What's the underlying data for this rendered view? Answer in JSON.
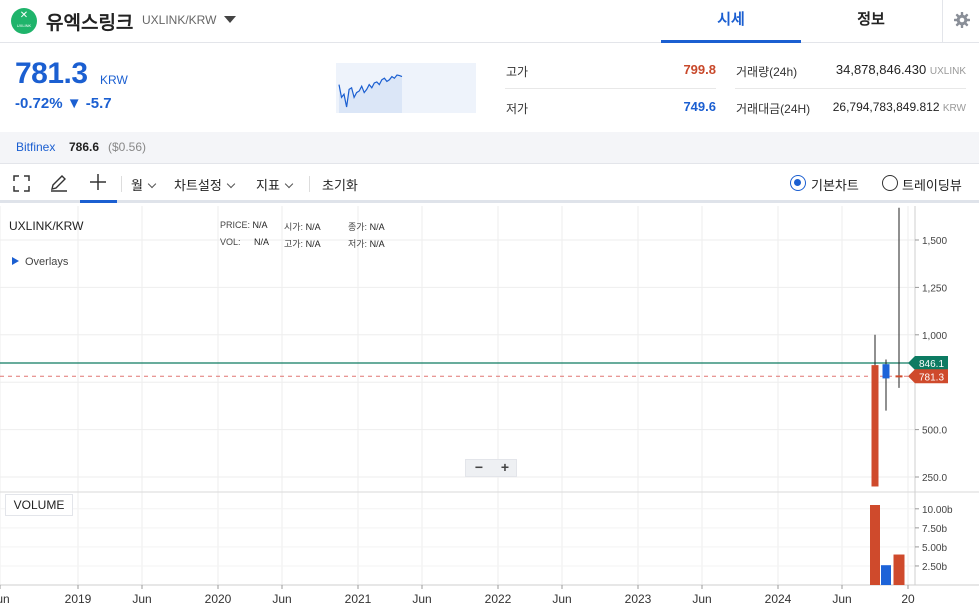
{
  "header": {
    "logo_text": "UXLINK",
    "coin_name": "유엑스링크",
    "pair": "UXLINK/KRW",
    "tabs": [
      {
        "label": "시세"
      },
      {
        "label": "정보"
      }
    ]
  },
  "summary": {
    "price": "781.3",
    "currency": "KRW",
    "change_pct": "-0.72%",
    "change_arrow": "▼",
    "change_abs": "-5.7",
    "high_label": "고가",
    "high_value": "799.8",
    "low_label": "저가",
    "low_value": "749.6",
    "volume_label": "거래량(24h)",
    "volume_value": "34,878,846.430",
    "volume_unit": "UXLINK",
    "amount_label": "거래대금(24H)",
    "amount_value": "26,794,783,849.812",
    "amount_unit": "KRW"
  },
  "bitfinex": {
    "name": "Bitfinex",
    "price": "786.6",
    "usd": "($0.56)"
  },
  "toolbar": {
    "period": "월",
    "chart_settings": "차트설정",
    "indicators": "지표",
    "reset": "초기화",
    "chart_basic": "기본차트",
    "chart_tradingview": "트레이딩뷰"
  },
  "chart": {
    "symbol": "UXLINK/KRW",
    "overlays": "Overlays",
    "ohlc_labels": {
      "price": "PRICE:",
      "open": "시가:",
      "close": "종가:",
      "vol": "VOL:",
      "high": "고가:",
      "low": "저가:"
    },
    "ohlc_value": "N/A",
    "volume_label": "VOLUME",
    "zoom_out": "−",
    "zoom_in": "+",
    "current_line_label": "846.1",
    "current_price_label": "781.3",
    "y_ticks": [
      "1,500",
      "1,250",
      "1,000",
      "500.0",
      "250.0"
    ],
    "vol_ticks": [
      "10.00b",
      "7.50b",
      "5.00b",
      "2.50b"
    ],
    "x_ticks": [
      "Jun",
      "2019",
      "Jun",
      "2020",
      "Jun",
      "2021",
      "Jun",
      "2022",
      "Jun",
      "2023",
      "Jun",
      "2024",
      "Jun",
      "20"
    ]
  },
  "chart_data": {
    "type": "candlestick",
    "interval": "monthly",
    "ylim": [
      0,
      1700
    ],
    "candles": [
      {
        "open": 840,
        "high": 1000,
        "low": 880,
        "close": 200,
        "color": "down"
      },
      {
        "open": 770,
        "high": 870,
        "low": 600,
        "close": 845,
        "color": "up"
      },
      {
        "open": 786,
        "high": 1670,
        "low": 720,
        "close": 781.3,
        "color": "down"
      }
    ],
    "volume": [
      {
        "value": 10.5,
        "unit": "b",
        "color": "down"
      },
      {
        "value": 2.6,
        "unit": "b",
        "color": "up"
      },
      {
        "value": 4.0,
        "unit": "b",
        "color": "down"
      }
    ],
    "horizontal_lines": [
      {
        "value": 846.1,
        "style": "solid",
        "color": "#0d7b62"
      },
      {
        "value": 781.3,
        "style": "dashed",
        "color": "#d9534f"
      }
    ],
    "colors": {
      "down": "#cf4a2c",
      "up": "#1d63d8"
    }
  },
  "sparkline": [
    830,
    790,
    800,
    760,
    815,
    820,
    790,
    805,
    810,
    825,
    805,
    815,
    830,
    820,
    835,
    838,
    830,
    845,
    850,
    840,
    845,
    855,
    850,
    860,
    858,
    855
  ]
}
